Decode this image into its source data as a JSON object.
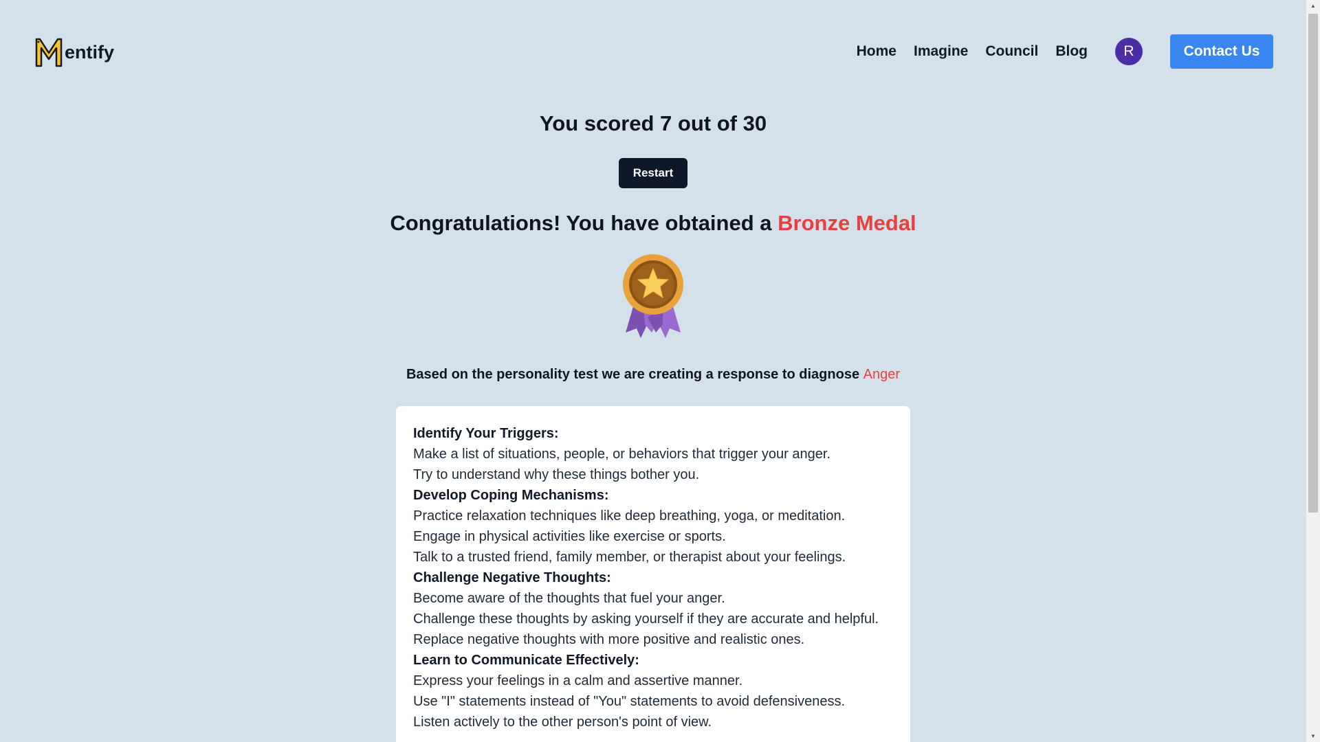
{
  "header": {
    "logo_letter": "M",
    "logo_text": "entify",
    "nav": [
      {
        "label": "Home"
      },
      {
        "label": "Imagine"
      },
      {
        "label": "Council"
      },
      {
        "label": "Blog"
      }
    ],
    "avatar_initial": "R",
    "contact_label": "Contact Us"
  },
  "result": {
    "score_text": "You scored 7 out of 30",
    "restart_label": "Restart",
    "congrats_prefix": "Congratulations! You have obtained a ",
    "medal_name": "Bronze Medal",
    "diagnose_prefix": "Based on the personality test we are creating a response to diagnose ",
    "diagnosis": "Anger"
  },
  "advice": [
    {
      "title": "Identify Your Triggers:",
      "tips": [
        "Make a list of situations, people, or behaviors that trigger your anger.",
        "Try to understand why these things bother you."
      ]
    },
    {
      "title": "Develop Coping Mechanisms:",
      "tips": [
        "Practice relaxation techniques like deep breathing, yoga, or meditation.",
        "Engage in physical activities like exercise or sports.",
        "Talk to a trusted friend, family member, or therapist about your feelings."
      ]
    },
    {
      "title": "Challenge Negative Thoughts:",
      "tips": [
        "Become aware of the thoughts that fuel your anger.",
        "Challenge these thoughts by asking yourself if they are accurate and helpful.",
        "Replace negative thoughts with more positive and realistic ones."
      ]
    },
    {
      "title": "Learn to Communicate Effectively:",
      "tips": [
        "Express your feelings in a calm and assertive manner.",
        "Use \"I\" statements instead of \"You\" statements to avoid defensiveness.",
        "Listen actively to the other person's point of view."
      ]
    }
  ],
  "colors": {
    "background": "#d5e1ea",
    "accent_red": "#ea3f3f",
    "contact_blue": "#3a86f0",
    "avatar_purple": "#4b2da5",
    "restart_dark": "#0f172a",
    "logo_yellow": "#f7c531"
  },
  "icons": {
    "logo": "mentify-m-logo-icon",
    "medal": "bronze-medal-icon",
    "scroll_up": "scroll-up-arrow-icon",
    "scroll_down": "scroll-down-arrow-icon"
  }
}
